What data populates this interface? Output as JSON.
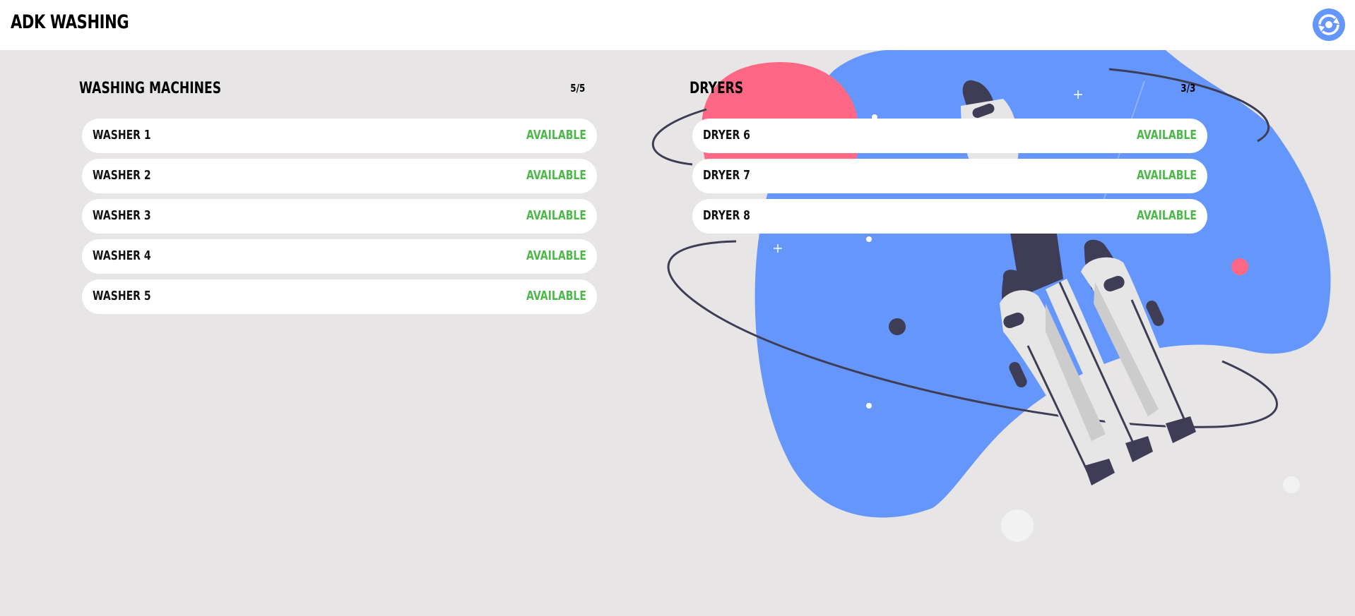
{
  "header": {
    "title": "ADK WASHING",
    "icon": "camera-rotate-icon"
  },
  "colors": {
    "background": "#e7e5e6",
    "header_bg": "#ffffff",
    "available": "#4cb84a",
    "accent_blue": "#6496fc",
    "accent_pink": "#ff6884",
    "dark": "#3f3d56"
  },
  "washers": {
    "title": "WASHING MACHINES",
    "count": "5/5",
    "items": [
      {
        "name": "WASHER 1",
        "status": "AVAILABLE"
      },
      {
        "name": "WASHER 2",
        "status": "AVAILABLE"
      },
      {
        "name": "WASHER 3",
        "status": "AVAILABLE"
      },
      {
        "name": "WASHER 4",
        "status": "AVAILABLE"
      },
      {
        "name": "WASHER 5",
        "status": "AVAILABLE"
      }
    ]
  },
  "dryers": {
    "title": "DRYERS",
    "count": "3/3",
    "items": [
      {
        "name": "DRYER 6",
        "status": "AVAILABLE"
      },
      {
        "name": "DRYER 7",
        "status": "AVAILABLE"
      },
      {
        "name": "DRYER 8",
        "status": "AVAILABLE"
      }
    ]
  }
}
